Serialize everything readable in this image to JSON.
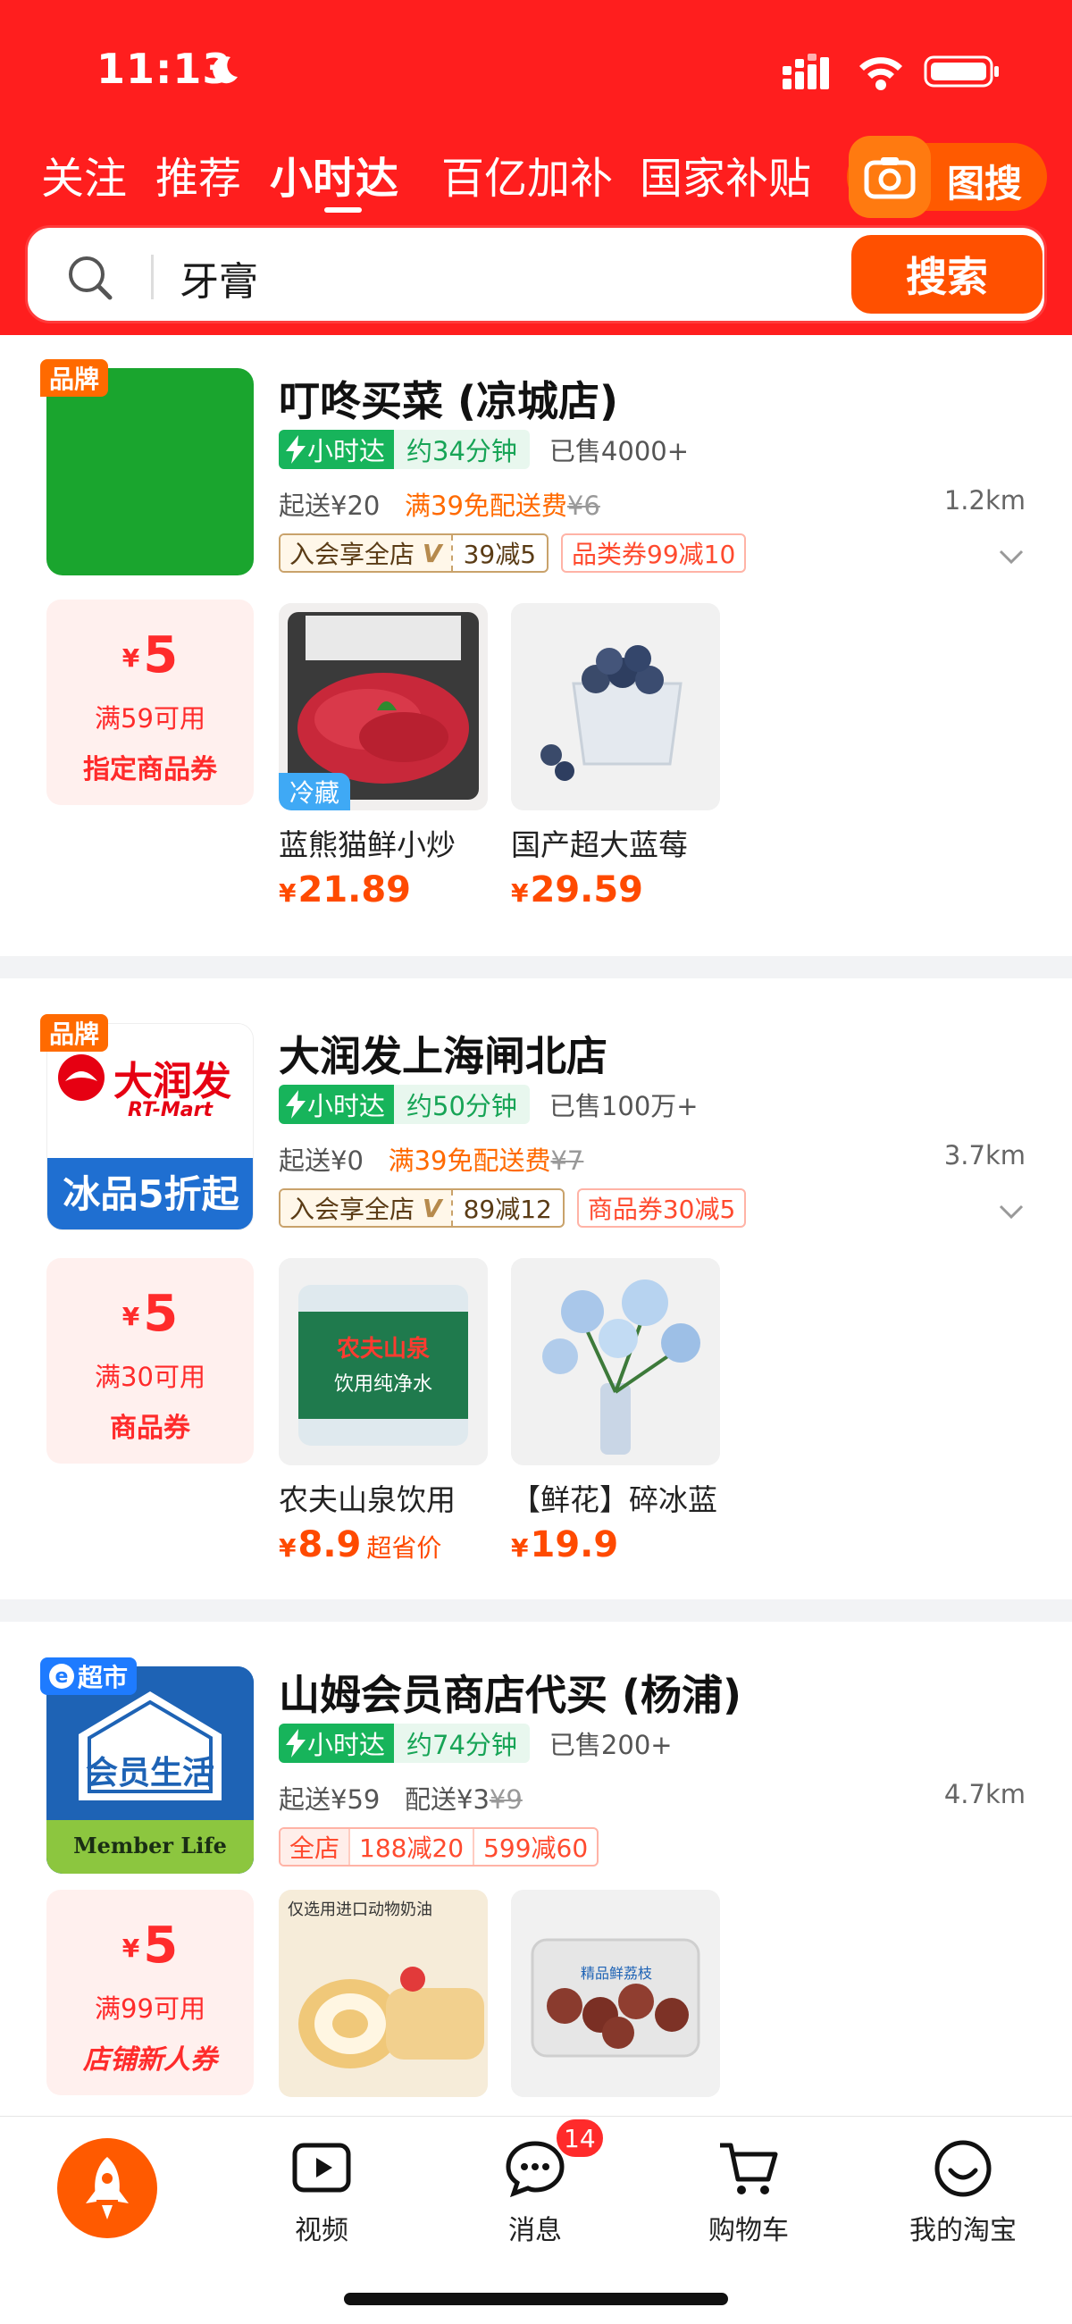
{
  "status_bar": {
    "time": "11:13"
  },
  "top_tabs": [
    "关注",
    "推荐",
    "小时达",
    "百亿加补",
    "国家补贴"
  ],
  "image_search_label": "图搜",
  "search": {
    "value": "牙膏",
    "button": "搜索"
  },
  "stores": [
    {
      "brand_tag": "品牌",
      "name": "叮咚买菜 (凉城店)",
      "badge": "小时达",
      "eta": "约34分钟",
      "sold": "已售4000+",
      "min_order": "起送¥20",
      "free_delivery": "满39免配送费",
      "old_fee": "¥6",
      "distance": "1.2km",
      "coupon1_left": "入会享全店",
      "coupon1_right": "39减5",
      "coupon2": "品类券99减10",
      "voucher": {
        "currency": "¥",
        "amount": "5",
        "condition": "满59可用",
        "type": "指定商品券"
      },
      "products": [
        {
          "name": "蓝熊猫鲜小炒",
          "currency": "¥",
          "price": "21.89",
          "tag": "冷藏"
        },
        {
          "name": "国产超大蓝莓",
          "currency": "¥",
          "price": "29.59"
        }
      ]
    },
    {
      "brand_tag": "品牌",
      "name": "大润发上海闸北店",
      "logo_text": "大润发",
      "logo_sub": "RT-Mart",
      "logo_banner": "冰品5折起",
      "badge": "小时达",
      "eta": "约50分钟",
      "sold": "已售100万+",
      "min_order": "起送¥0",
      "free_delivery": "满39免配送费",
      "old_fee": "¥7",
      "distance": "3.7km",
      "coupon1_left": "入会享全店",
      "coupon1_right": "89减12",
      "coupon2": "商品券30减5",
      "voucher": {
        "currency": "¥",
        "amount": "5",
        "condition": "满30可用",
        "type": "商品券"
      },
      "products": [
        {
          "name": "农夫山泉饮用",
          "currency": "¥",
          "price": "8.9",
          "tag": "超省价"
        },
        {
          "name": "【鲜花】碎冰蓝",
          "currency": "¥",
          "price": "19.9"
        }
      ]
    },
    {
      "brand_tag": "超市",
      "name": "山姆会员商店代买 (杨浦)",
      "logo_text": "会员生活",
      "logo_sub": "Member Life",
      "badge": "小时达",
      "eta": "约74分钟",
      "sold": "已售200+",
      "min_order": "起送¥59",
      "delivery": "配送¥3",
      "old_fee": "¥9",
      "distance": "4.7km",
      "coupon_label": "全店",
      "coupon_a": "188减20",
      "coupon_b": "599减60",
      "voucher": {
        "currency": "¥",
        "amount": "5",
        "condition": "满99可用",
        "type": "店铺新人券"
      },
      "products": [
        {
          "name": "",
          "img_text": "仅选用进口动物奶油"
        },
        {
          "name": "",
          "img_text": "精品鲜荔枝"
        }
      ]
    }
  ],
  "tab_bar": {
    "items": [
      "视频",
      "消息",
      "购物车",
      "我的淘宝"
    ],
    "message_badge": "14"
  },
  "colors": {
    "header_red": "#ff1e1e",
    "accent_orange": "#ff5000",
    "green": "#17b45b"
  }
}
